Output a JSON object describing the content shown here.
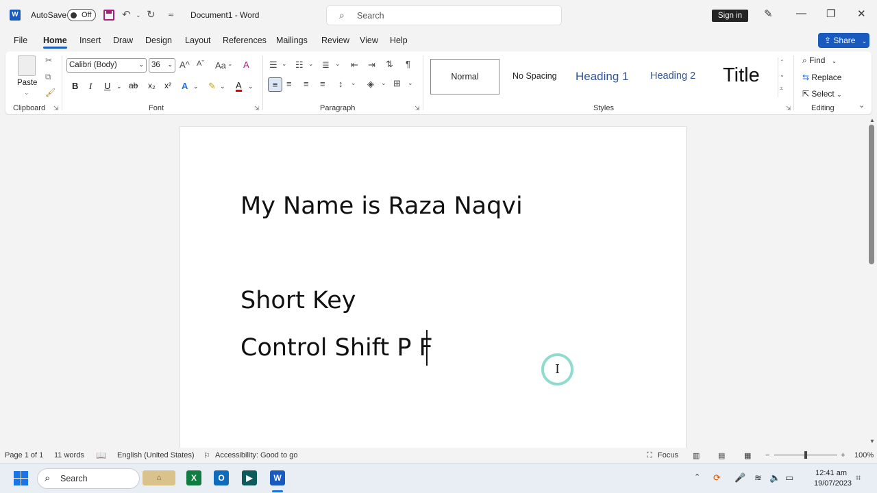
{
  "titlebar": {
    "autosave_label": "AutoSave",
    "autosave_state": "Off",
    "doc_title": "Document1  -  Word",
    "search_placeholder": "Search",
    "signin": "Sign in"
  },
  "menu": {
    "items": [
      "File",
      "Home",
      "Insert",
      "Draw",
      "Design",
      "Layout",
      "References",
      "Mailings",
      "Review",
      "View",
      "Help"
    ],
    "active": "Home",
    "share": "Share"
  },
  "ribbon": {
    "clipboard": {
      "paste": "Paste",
      "label": "Clipboard"
    },
    "font": {
      "family": "Calibri (Body)",
      "size": "36",
      "label": "Font",
      "bold": "B",
      "italic": "I",
      "underline": "U",
      "strike": "ab",
      "sub": "x₂",
      "sup": "x²",
      "grow": "A^",
      "shrink": "Aˇ",
      "case": "Aa",
      "color_a": "A",
      "effects_a": "A",
      "clear_a": "A"
    },
    "paragraph": {
      "label": "Paragraph",
      "pilcrow": "¶"
    },
    "styles": {
      "label": "Styles",
      "items": [
        "Normal",
        "No Spacing",
        "Heading 1",
        "Heading 2",
        "Title"
      ]
    },
    "editing": {
      "label": "Editing",
      "find": "Find",
      "replace": "Replace",
      "select": "Select"
    }
  },
  "document": {
    "lines": [
      "My Name is Raza Naqvi",
      "Short Key",
      "Control Shift P F"
    ]
  },
  "status": {
    "page": "Page 1 of 1",
    "words": "11 words",
    "language": "English (United States)",
    "accessibility": "Accessibility: Good to go",
    "focus": "Focus",
    "zoom": "100%"
  },
  "taskbar": {
    "search": "Search",
    "time": "12:41 am",
    "date": "19/07/2023"
  },
  "colors": {
    "word_blue": "#185abd",
    "save_purple": "#a4207d",
    "cursor_ring": "#8fdccf"
  }
}
